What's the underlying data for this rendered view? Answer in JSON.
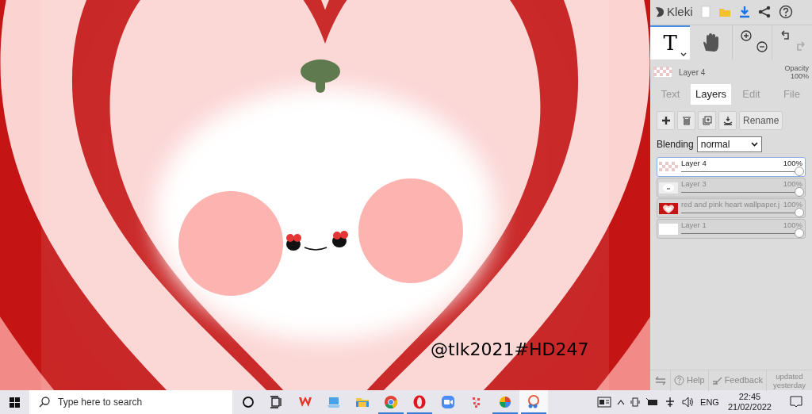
{
  "app": {
    "logo": "Kleki"
  },
  "tools": [
    {
      "kind": "text",
      "label": "T",
      "selected": true
    },
    {
      "kind": "hand",
      "selected": false
    }
  ],
  "current_layer": {
    "name": "Layer 4",
    "opacity_label": "Opacity",
    "opacity": "100%"
  },
  "tabs": [
    {
      "label": "Text",
      "selected": false
    },
    {
      "label": "Layers",
      "selected": true
    },
    {
      "label": "Edit",
      "selected": false
    },
    {
      "label": "File",
      "selected": false
    }
  ],
  "layer_actions": {
    "rename": "Rename"
  },
  "blending": {
    "label": "Blending",
    "value": "normal"
  },
  "layers": [
    {
      "name": "Layer 4",
      "opacity": "100%",
      "level": 1,
      "selected": true,
      "kind": "transparent"
    },
    {
      "name": "Layer 3",
      "opacity": "100%",
      "level": 1,
      "selected": false,
      "kind": "face"
    },
    {
      "name": "red and pink heart wallpaper.j",
      "opacity": "100%",
      "level": 1,
      "selected": false,
      "kind": "heart"
    },
    {
      "name": "Layer 1",
      "opacity": "100%",
      "level": 1,
      "selected": false,
      "kind": "white"
    }
  ],
  "footer": {
    "help": "Help",
    "feedback": "Feedback",
    "update_note": "updated yesterday"
  },
  "canvas": {
    "signature": "@tlk2021#HD247"
  },
  "taskbar": {
    "search_placeholder": "Type here to search",
    "apps": [
      {
        "kind": "cortana",
        "running": false,
        "selected": false
      },
      {
        "kind": "taskview",
        "running": false,
        "selected": false
      },
      {
        "kind": "wps",
        "running": false,
        "selected": false
      },
      {
        "kind": "laptop",
        "running": false,
        "selected": false
      },
      {
        "kind": "folder",
        "running": false,
        "selected": false
      },
      {
        "kind": "chrome",
        "running": true,
        "selected": false
      },
      {
        "kind": "opera",
        "running": true,
        "selected": false
      },
      {
        "kind": "zoom",
        "running": false,
        "selected": false
      },
      {
        "kind": "grid",
        "running": false,
        "selected": false
      },
      {
        "kind": "colorwheel",
        "running": true,
        "selected": false
      },
      {
        "kind": "paint",
        "running": true,
        "selected": true
      }
    ],
    "language": "ENG",
    "time": "22:45",
    "date": "21/02/2022"
  }
}
